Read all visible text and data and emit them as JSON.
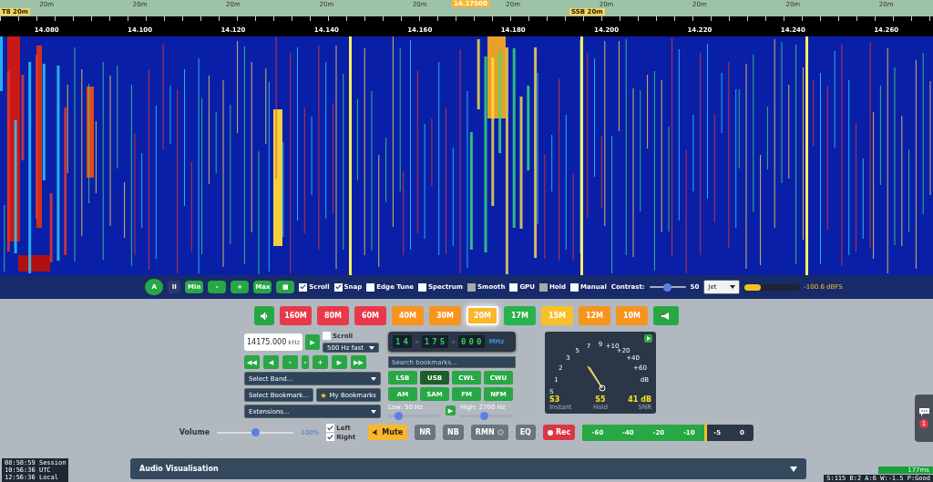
{
  "band_strip": {
    "labels": [
      "20m",
      "20m",
      "20m",
      "20m",
      "20m",
      "20m",
      "20m",
      "20m",
      "20m",
      "20m"
    ],
    "markers": [
      {
        "text": "T8 20m",
        "kind": "edge"
      },
      {
        "text": "14.17500",
        "kind": "tuned"
      },
      {
        "text": "SSB 20m",
        "kind": "band"
      }
    ]
  },
  "scale": {
    "labels": [
      "14.080",
      "14.100",
      "14.120",
      "14.140",
      "14.160",
      "14.180",
      "14.200",
      "14.220",
      "14.240",
      "14.260"
    ]
  },
  "waterfall_toolbar": {
    "buttons": [
      {
        "label": "A",
        "kind": "round"
      },
      {
        "label": "II",
        "kind": "dark"
      },
      {
        "label": "Min",
        "kind": "green"
      },
      {
        "label": "-",
        "kind": "green"
      },
      {
        "label": "+",
        "kind": "green"
      },
      {
        "label": "Max",
        "kind": "green"
      },
      {
        "label": "■",
        "kind": "green"
      }
    ],
    "checkboxes": [
      {
        "label": "Scroll",
        "checked": true,
        "disabled": false
      },
      {
        "label": "Snap",
        "checked": true,
        "disabled": false
      },
      {
        "label": "Edge Tune",
        "checked": false,
        "disabled": false
      },
      {
        "label": "Spectrum",
        "checked": false,
        "disabled": false
      },
      {
        "label": "Smooth",
        "checked": false,
        "disabled": true
      },
      {
        "label": "GPU",
        "checked": false,
        "disabled": false
      },
      {
        "label": "Hold",
        "checked": false,
        "disabled": true
      },
      {
        "label": "Manual",
        "checked": false,
        "disabled": false
      }
    ],
    "contrast": {
      "label": "Contrast:",
      "level": 0.5,
      "reading": "50"
    },
    "colormap": "Jet",
    "signal": {
      "level": 0.3,
      "reading": "-100.6 dBFS"
    }
  },
  "bands": [
    {
      "label": "160M",
      "color": "#e8394a",
      "selected": false
    },
    {
      "label": "80M",
      "color": "#e8394a",
      "selected": false
    },
    {
      "label": "60M",
      "color": "#e8394a",
      "selected": false
    },
    {
      "label": "40M",
      "color": "#f7941d",
      "selected": false
    },
    {
      "label": "30M",
      "color": "#f7941d",
      "selected": false
    },
    {
      "label": "20M",
      "color": "#f9b72a",
      "selected": true
    },
    {
      "label": "17M",
      "color": "#28b24b",
      "selected": false
    },
    {
      "label": "15M",
      "color": "#f9c02a",
      "selected": false
    },
    {
      "label": "12M",
      "color": "#f7941d",
      "selected": false
    },
    {
      "label": "10M",
      "color": "#f7941d",
      "selected": false
    }
  ],
  "frequency": {
    "value": "14175.000",
    "unit": "kHz",
    "go": "▶",
    "scroll": {
      "label": "Scroll",
      "checked": false
    },
    "step": "500 Hz fast"
  },
  "tuning_buttons": [
    "◀◀",
    "◀",
    "-",
    "-",
    "+",
    "▶",
    "▶▶"
  ],
  "selects": {
    "band": "Select Band...",
    "bookmark": "Select Bookmark...",
    "my_bookmarks": "My Bookmarks",
    "extensions": "Extensions..."
  },
  "digits": {
    "groups": [
      "14",
      "175",
      "000"
    ],
    "unit": "MHz"
  },
  "bookmark_search": {
    "placeholder": "Search bookmarks..."
  },
  "modes": [
    {
      "label": "LSB",
      "selected": false
    },
    {
      "label": "USB",
      "selected": true
    },
    {
      "label": "CWL",
      "selected": false
    },
    {
      "label": "CWU",
      "selected": false
    },
    {
      "label": "AM",
      "selected": false
    },
    {
      "label": "SAM",
      "selected": false
    },
    {
      "label": "FM",
      "selected": false
    },
    {
      "label": "NFM",
      "selected": false
    }
  ],
  "filter": {
    "low": {
      "label": "Low: 50 Hz",
      "level": 0.2
    },
    "high": {
      "label": "High: 2700 Hz",
      "level": 0.45
    },
    "apply": "▶"
  },
  "s_meter": {
    "scale": [
      "1",
      "2",
      "3",
      "5",
      "7",
      "9",
      "+10",
      "+20",
      "+40",
      "+60",
      "dB"
    ],
    "zero": "S",
    "readings": [
      {
        "value": "S3",
        "caption": "Instant"
      },
      {
        "value": "S5",
        "caption": "Hold"
      },
      {
        "value": "41 dB",
        "caption": "SNR"
      }
    ]
  },
  "audio": {
    "volume": {
      "label": "Volume",
      "level": 0.5,
      "reading": "100%"
    },
    "channels": [
      {
        "label": "Left",
        "checked": true
      },
      {
        "label": "Right",
        "checked": true
      }
    ],
    "buttons": [
      {
        "label": "Mute",
        "kind": "mute"
      },
      {
        "label": "NR",
        "kind": "plain"
      },
      {
        "label": "NB",
        "kind": "plain"
      },
      {
        "label": "RMN",
        "kind": "gear"
      },
      {
        "label": "EQ",
        "kind": "plain"
      },
      {
        "label": "Rec",
        "kind": "rec"
      }
    ],
    "meter": {
      "level": 0.73,
      "labels": [
        "-60",
        "-40",
        "-20",
        "-10",
        "-5",
        "0"
      ]
    }
  },
  "clock": [
    "08:58:59 Session",
    "10:56:36 UTC",
    "12:56:36 Local"
  ],
  "panel": {
    "title": "Audio Visualisation",
    "expanded": false
  },
  "status": {
    "latency": "177ms",
    "stats": "S:115 B:2 A:6 W:-1.5 P:Good"
  },
  "chat": {
    "badge": "1"
  }
}
